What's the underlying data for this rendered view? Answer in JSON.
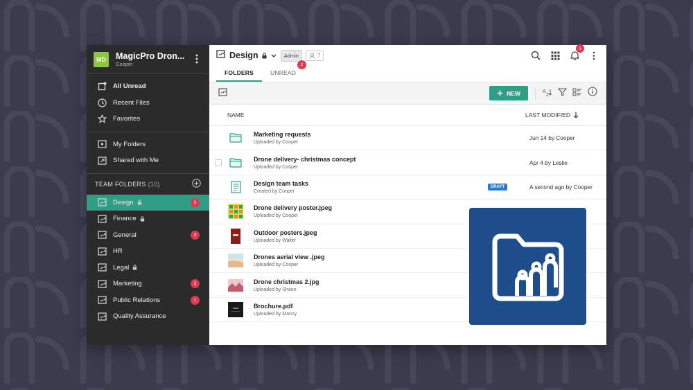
{
  "org": {
    "initials": "MD",
    "name": "MagicPro Dron...",
    "user": "Cooper"
  },
  "sidebar": {
    "primary": [
      {
        "label": "All Unread",
        "icon": "all-unread-icon"
      },
      {
        "label": "Recent Files",
        "icon": "clock-icon"
      },
      {
        "label": "Favorites",
        "icon": "star-icon"
      }
    ],
    "personal": [
      {
        "label": "My Folders",
        "icon": "my-folders-icon"
      },
      {
        "label": "Shared with Me",
        "icon": "shared-folder-icon"
      }
    ],
    "team_header": "TEAM FOLDERS",
    "team_count": "(10)",
    "team_folders": [
      {
        "label": "Design",
        "locked": true,
        "badge": "2",
        "active": true
      },
      {
        "label": "Finance",
        "locked": true,
        "badge": ""
      },
      {
        "label": "General",
        "locked": false,
        "badge": "3"
      },
      {
        "label": "HR",
        "locked": false,
        "badge": ""
      },
      {
        "label": "Legal",
        "locked": true,
        "badge": ""
      },
      {
        "label": "Marketing",
        "locked": false,
        "badge": "2"
      },
      {
        "label": "Public Relations",
        "locked": false,
        "badge": "1"
      },
      {
        "label": "Quality Assurance",
        "locked": false,
        "badge": ""
      }
    ]
  },
  "header": {
    "title": "Design",
    "role": "Admin",
    "members": "7",
    "notifications": "5"
  },
  "tabs": [
    {
      "label": "FOLDERS",
      "active": true,
      "badge": ""
    },
    {
      "label": "UNREAD",
      "active": false,
      "badge": "2"
    }
  ],
  "toolbar": {
    "new_label": "NEW"
  },
  "list": {
    "col_name": "NAME",
    "col_modified": "LAST MODIFIED",
    "rows": [
      {
        "name": "Marketing requests",
        "sub": "Uploaded by Cooper",
        "modified": "Jun 14 by Cooper",
        "kind": "folder",
        "draft": ""
      },
      {
        "name": "Drone delivery- christmas concept",
        "sub": "Uploaded by Cooper",
        "modified": "Apr 4 by Leslie",
        "kind": "folder",
        "draft": "",
        "checkbox": true
      },
      {
        "name": "Design team tasks",
        "sub": "Created by Cooper",
        "modified": "A second ago by Cooper",
        "kind": "doc",
        "draft": "DRAFT"
      },
      {
        "name": "Drone delivery poster.jpeg",
        "sub": "Uploaded by Cooper",
        "modified": "",
        "kind": "img-green",
        "draft": ""
      },
      {
        "name": "Outdoor posters.jpeg",
        "sub": "Uploaded by Walter",
        "modified": "",
        "kind": "img-red",
        "draft": ""
      },
      {
        "name": "Drones aerial view .jpeg",
        "sub": "Uploaded by Cooper",
        "modified": "",
        "kind": "img-beach",
        "draft": ""
      },
      {
        "name": "Drone christmas 2.jpg",
        "sub": "Uploaded by Shaun",
        "modified": "",
        "kind": "img-pink",
        "draft": ""
      },
      {
        "name": "Brochure.pdf",
        "sub": "Uploaded by Manny",
        "modified": "",
        "kind": "img-dark",
        "draft": ""
      }
    ]
  },
  "colors": {
    "accent": "#2e9e84",
    "badge": "#e0394f",
    "sidebar": "#2b2b2b",
    "logo_tile": "#1e4d8c"
  }
}
